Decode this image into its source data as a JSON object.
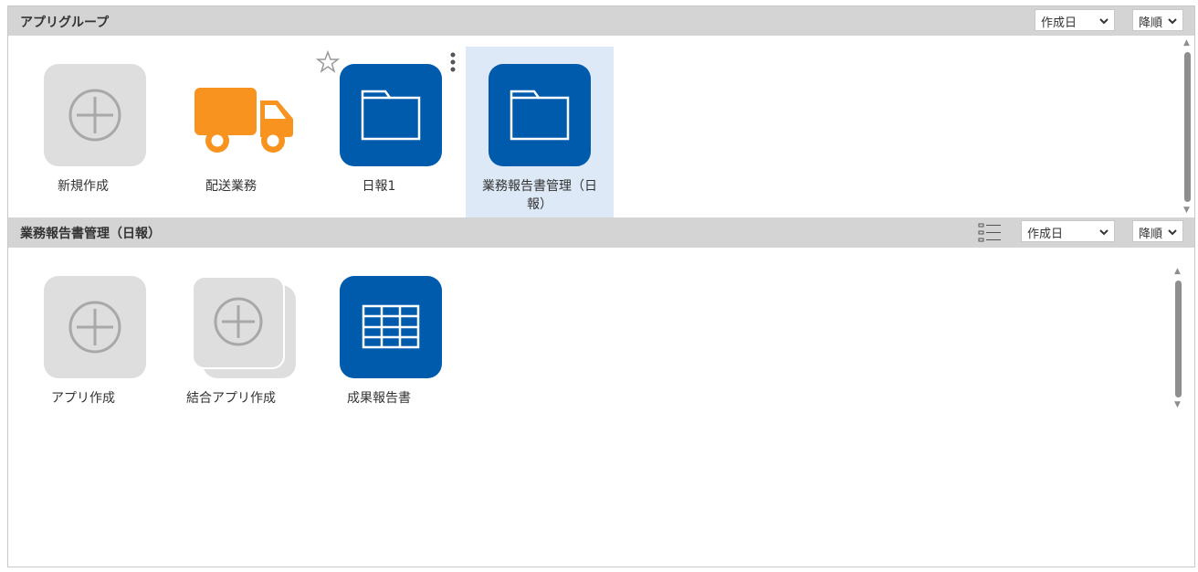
{
  "group_panel": {
    "title": "アプリグループ",
    "sort_field": "作成日",
    "sort_order": "降順",
    "tiles": [
      {
        "label": "新規作成",
        "icon": "add-icon"
      },
      {
        "label": "配送業務",
        "icon": "truck-icon"
      },
      {
        "label": "日報1",
        "icon": "folder-icon"
      },
      {
        "label": "業務報告書管理（日報）",
        "icon": "folder-icon"
      }
    ]
  },
  "detail_panel": {
    "title": "業務報告書管理（日報）",
    "sort_field": "作成日",
    "sort_order": "降順",
    "tiles": [
      {
        "label": "アプリ作成",
        "icon": "add-icon"
      },
      {
        "label": "結合アプリ作成",
        "icon": "stacked-add-icon"
      },
      {
        "label": "成果報告書",
        "icon": "table-icon"
      }
    ]
  },
  "colors": {
    "accent": "#005bac",
    "truck": "#f7931e",
    "selected_bg": "#dde9f6"
  }
}
